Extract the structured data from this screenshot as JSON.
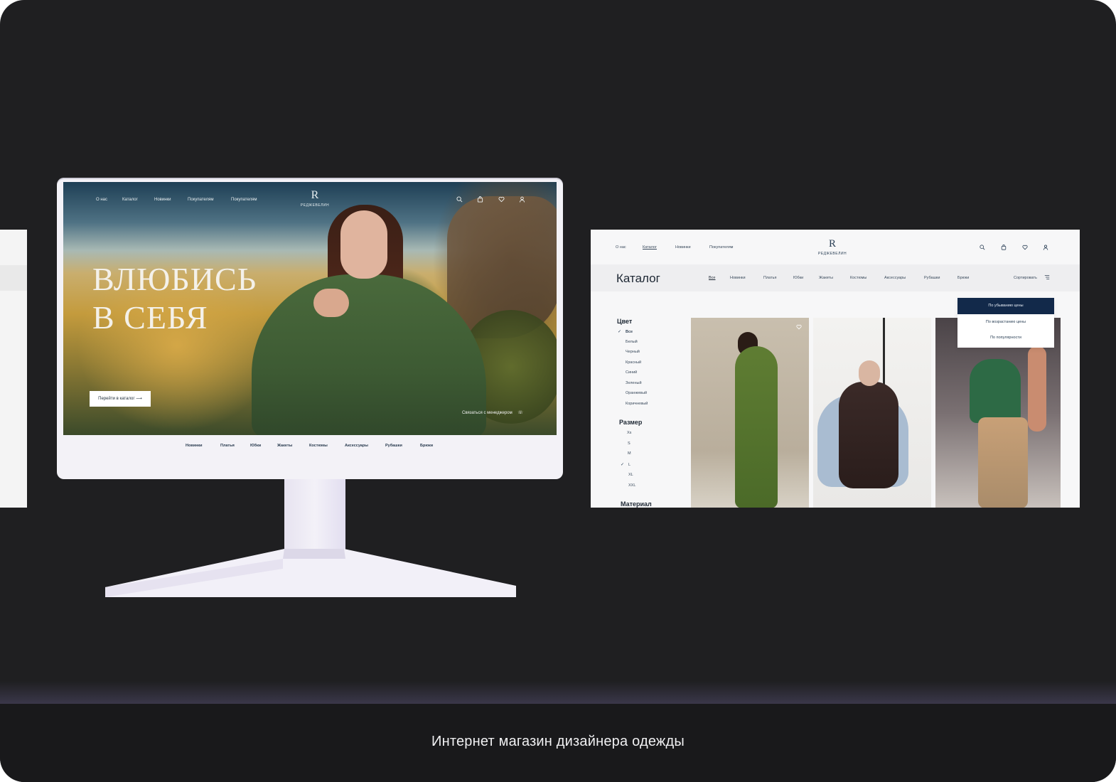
{
  "caption": "Интернет магазин дизайнера одежды",
  "brand": {
    "logo_mark": "R",
    "logo_word": "РЕДЖЕВЕЛИН"
  },
  "hero": {
    "nav": [
      "О нас",
      "Каталог",
      "Новинки",
      "Покупателям",
      "Покупателям"
    ],
    "icons": [
      "search-icon",
      "bag-icon",
      "heart-icon",
      "user-icon"
    ],
    "title_line1": "ВЛЮБИСЬ",
    "title_line2": "В СЕБЯ",
    "cta_label": "Перейти в каталог",
    "cta_arrow": "⟶",
    "contact_label": "Связаться с менеджером",
    "contact_icon": "☏",
    "categories": [
      "Новинки",
      "Платья",
      "Юбки",
      "Жакеты",
      "Костюмы",
      "Аксессуары",
      "Рубашки",
      "Брюки"
    ]
  },
  "catalog": {
    "nav": [
      "О нас",
      "Каталог",
      "Новинки",
      "Покупателям"
    ],
    "title": "Каталог",
    "tabs": [
      "Все",
      "Новинки",
      "Платья",
      "Юбки",
      "Жакеты",
      "Костюмы",
      "Аксессуары",
      "Рубашки",
      "Брюки"
    ],
    "sort_label": "Сортировать",
    "sort_options": [
      "По убыванию цены",
      "По возрастанию цены",
      "По популярности"
    ],
    "filters": {
      "color_heading": "Цвет",
      "colors": [
        "Все",
        "Белый",
        "Черный",
        "Красный",
        "Синий",
        "Зеленый",
        "Оранжевый",
        "Коричневый"
      ],
      "size_heading": "Размер",
      "sizes": [
        "Xs",
        "S",
        "M",
        "L",
        "XL",
        "XXL"
      ],
      "material_heading": "Материал"
    },
    "checkmark": "✓"
  },
  "colors": {
    "page_bg": "#1f1f21",
    "accent_navy": "#12294a",
    "monitor": "#f3f2f7"
  }
}
